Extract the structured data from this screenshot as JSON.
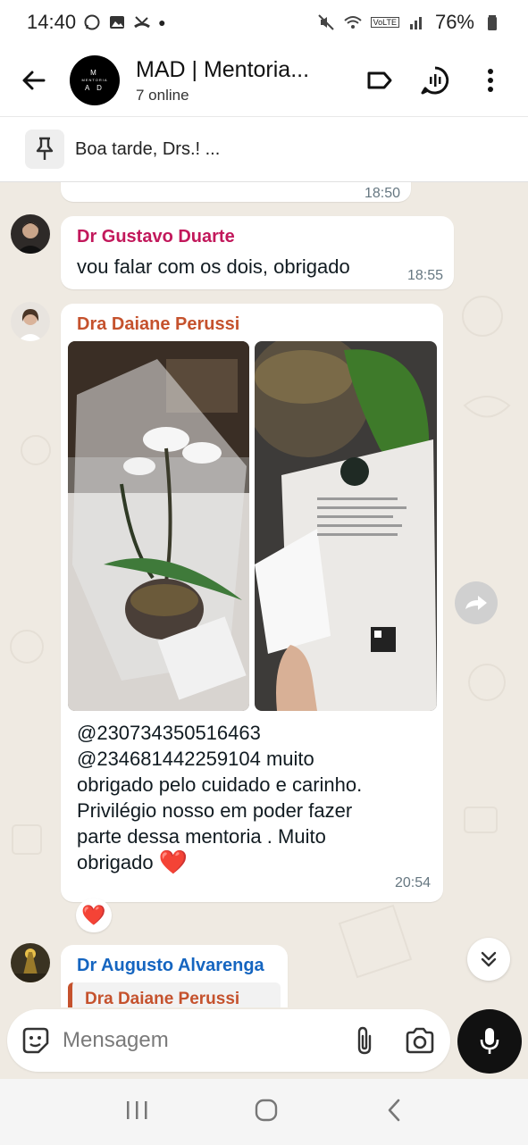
{
  "status_bar": {
    "time": "14:40",
    "battery": "76%",
    "network_badge": "VoLTE",
    "icons": [
      "whatsapp-icon",
      "gallery-icon",
      "missed-call-icon",
      "dot-icon",
      "mute-icon",
      "wifi-icon",
      "signal-icon",
      "battery-icon"
    ]
  },
  "header": {
    "title": "MAD | Mentoria...",
    "subtitle": "7 online",
    "logo": {
      "top": "M",
      "middle": "MENTORIA",
      "bottom": "A D"
    }
  },
  "pinned": {
    "text": "Boa tarde, Drs.! ..."
  },
  "messages": [
    {
      "time": "18:50"
    },
    {
      "sender": "Dr Gustavo Duarte",
      "sender_color": "#c2185b",
      "text": "vou falar com os dois, obrigado",
      "time": "18:55"
    },
    {
      "sender": "Dra Daiane Perussi",
      "sender_color": "#c5522d",
      "lines": [
        "@230734350516463",
        "@234681442259104  muito",
        "obrigado pelo cuidado e carinho.",
        "Privilégio nosso em poder fazer",
        "parte dessa mentoria . Muito",
        "obrigado"
      ],
      "emoji": "❤️",
      "time": "20:54",
      "reaction": "❤️"
    },
    {
      "sender": "Dr Augusto Alvarenga",
      "sender_color": "#1565c0",
      "quote_sender": "Dra Daiane Perussi"
    }
  ],
  "input": {
    "placeholder": "Mensagem"
  },
  "colors": {
    "accent": "#111111",
    "chat_bg": "#efeae2"
  }
}
